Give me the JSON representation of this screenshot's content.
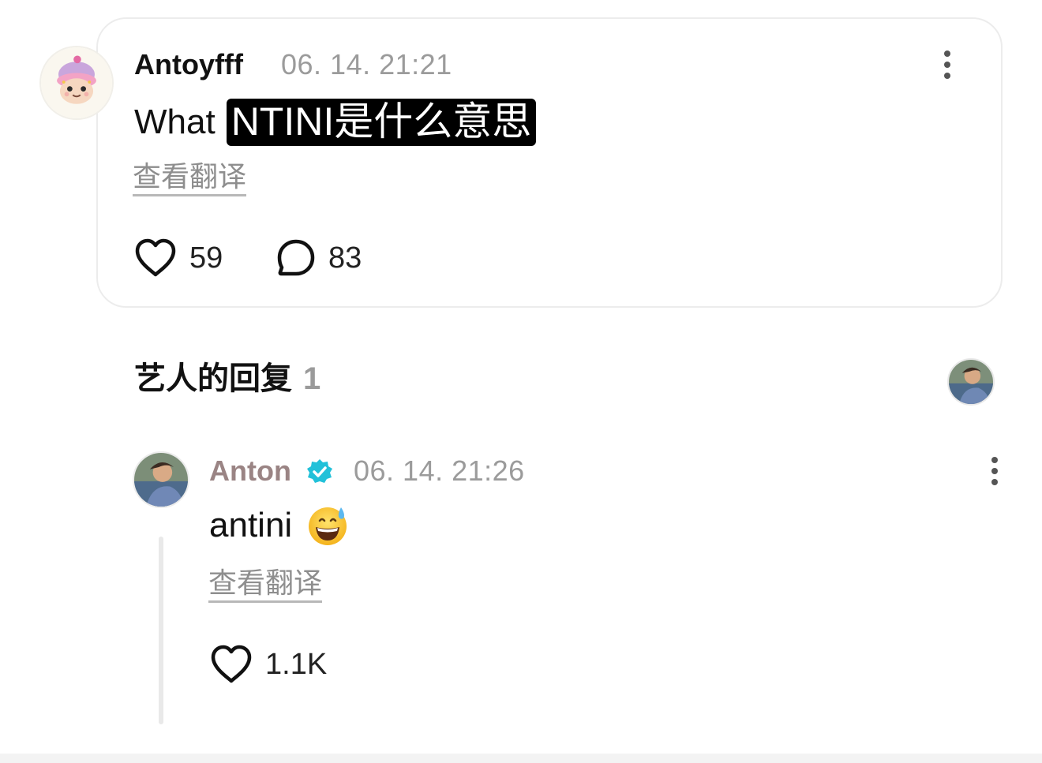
{
  "post": {
    "username": "Antoyfff",
    "timestamp": "06. 14. 21:21",
    "text_prefix": "What",
    "text_highlight": "NTINI是什么意思",
    "translate_label": "查看翻译",
    "likes": "59",
    "comments": "83",
    "icons": {
      "like": "heart-icon",
      "comment": "speech-bubble-icon",
      "more": "more-vertical-icon"
    }
  },
  "replies_section": {
    "title": "艺人的回复",
    "count": "1"
  },
  "reply": {
    "username": "Anton",
    "verified": true,
    "timestamp": "06. 14. 21:26",
    "text": "antini",
    "emoji": "grinning-face-with-sweat",
    "translate_label": "查看翻译",
    "likes": "1.1K",
    "name_color": "#9a8484",
    "badge_color": "#22c1d9"
  }
}
